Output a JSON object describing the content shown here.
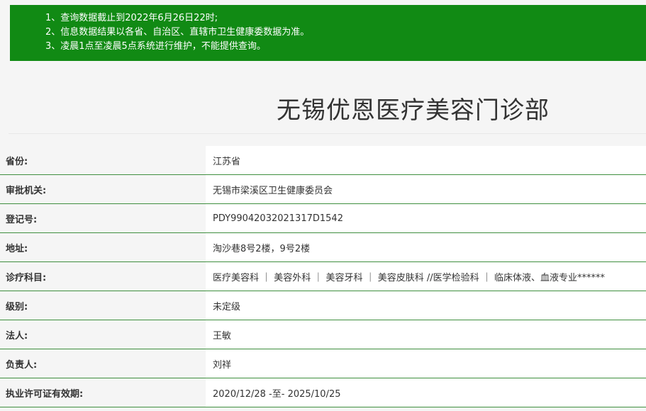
{
  "notice": {
    "lines": [
      "1、查询数据截止到2022年6月26日22时;",
      "2、信息数据结果以各省、自治区、直辖市卫生健康委数据为准。",
      "3、凌晨1点至凌晨5点系统进行维护，不能提供查询。"
    ]
  },
  "title": "无锡优恩医疗美容门诊部",
  "rows": [
    {
      "label": "省份:",
      "value": "江苏省"
    },
    {
      "label": "审批机关:",
      "value": "无锡市梁溪区卫生健康委员会"
    },
    {
      "label": "登记号:",
      "value": "PDY99042032021317D1542"
    },
    {
      "label": "地址:",
      "value": "淘沙巷8号2楼，9号2楼"
    },
    {
      "label": "诊疗科目:",
      "value": "医疗美容科 ｜ 美容外科 ｜ 美容牙科 ｜ 美容皮肤科 //医学检验科 ｜ 临床体液、血液专业******"
    },
    {
      "label": "级别:",
      "value": "未定级"
    },
    {
      "label": "法人:",
      "value": "王敏"
    },
    {
      "label": "负责人:",
      "value": "刘祥"
    },
    {
      "label": "执业许可证有效期:",
      "value": "2020/12/28 -至- 2025/10/25"
    }
  ],
  "colors": {
    "notice_bg": "#118a14",
    "row_border": "#3f8f3f"
  }
}
